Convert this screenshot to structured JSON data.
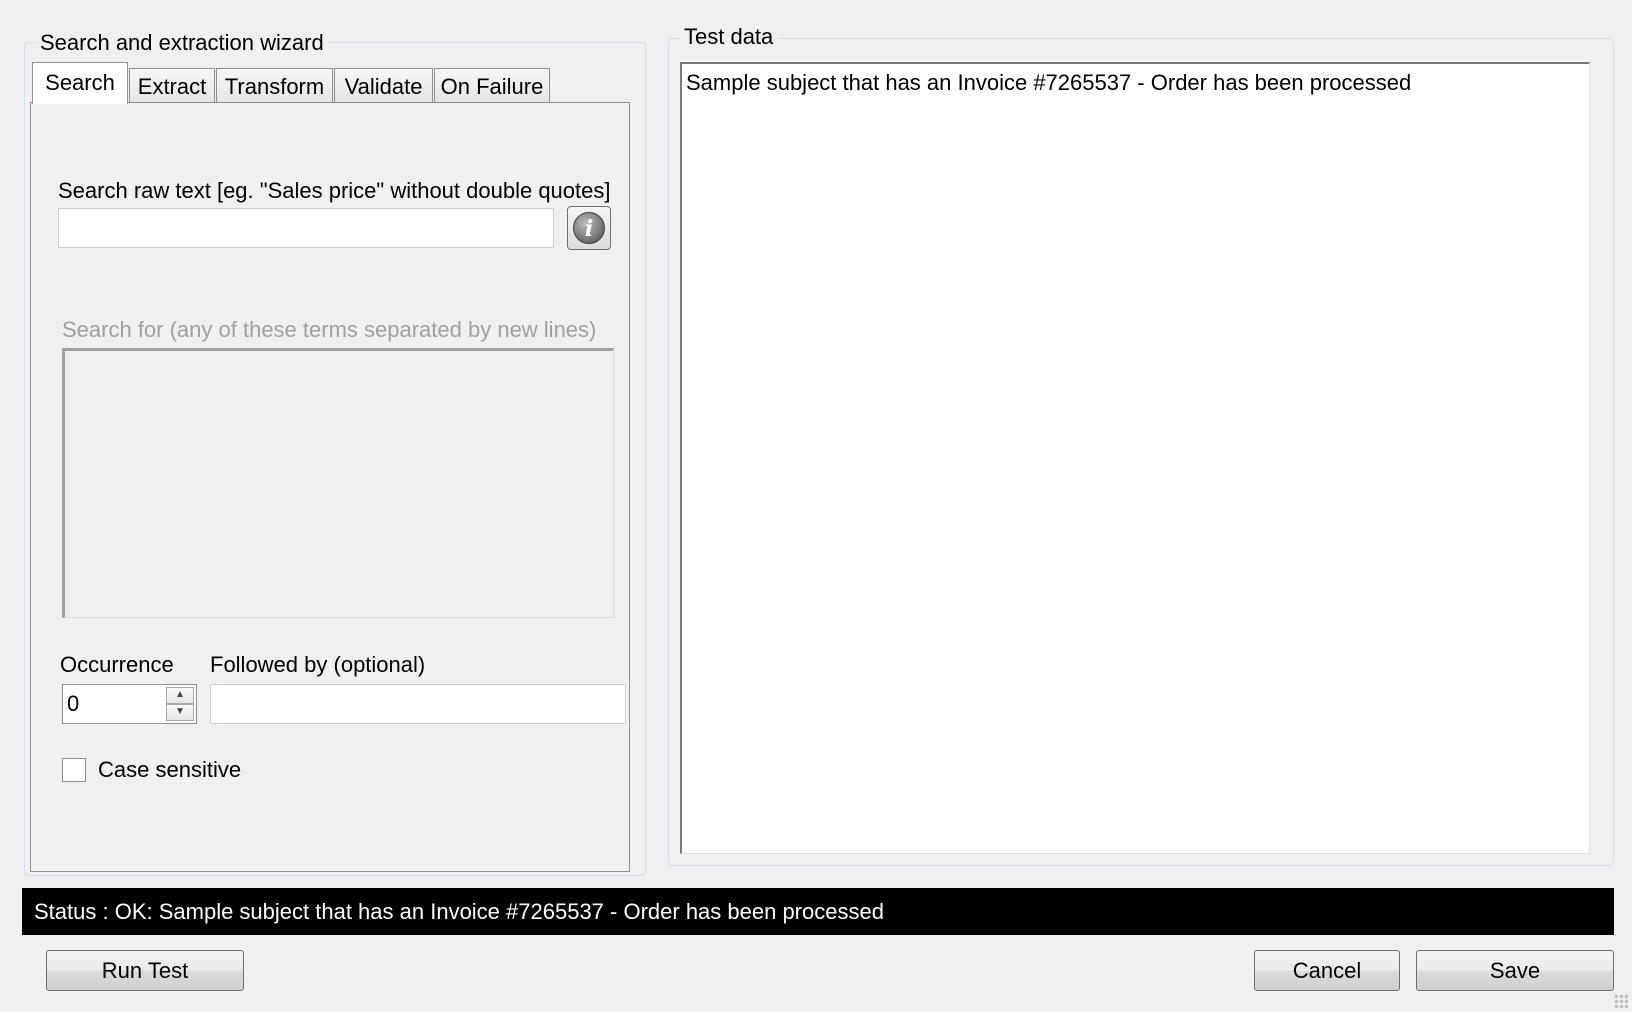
{
  "wizard": {
    "title": "Search and extraction wizard",
    "tabs": [
      {
        "label": "Search",
        "active": true
      },
      {
        "label": "Extract",
        "active": false
      },
      {
        "label": "Transform",
        "active": false
      },
      {
        "label": "Validate",
        "active": false
      },
      {
        "label": "On Failure",
        "active": false
      }
    ],
    "search": {
      "raw_text_label": "Search raw text [eg. \"Sales price\" without double quotes]",
      "raw_text_value": "",
      "info_icon": "info-icon",
      "search_for_label": "Search for (any of these terms separated by new lines)",
      "search_for_value": "",
      "occurrence_label": "Occurrence",
      "occurrence_value": "0",
      "followed_by_label": "Followed by (optional)",
      "followed_by_value": "",
      "case_sensitive_label": "Case sensitive",
      "case_sensitive_checked": false
    }
  },
  "test_data": {
    "title": "Test data",
    "content": "Sample subject that has an Invoice #7265537 - Order has been processed"
  },
  "status": {
    "text": "Status :  OK: Sample subject that has an Invoice #7265537 - Order has been processed"
  },
  "buttons": {
    "run_test": "Run Test",
    "cancel": "Cancel",
    "save": "Save"
  },
  "colors": {
    "status_background": "#000000",
    "status_text": "#ffffff",
    "window_background": "#f0f0f0"
  }
}
